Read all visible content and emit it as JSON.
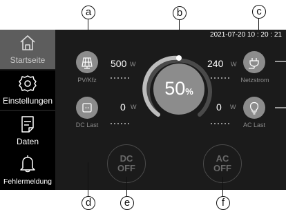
{
  "callouts": {
    "a": "a",
    "b": "b",
    "c": "c",
    "d": "d",
    "e": "e",
    "f": "f"
  },
  "datetime": "2021-07-20  10 : 20 : 21",
  "sidebar": {
    "items": [
      {
        "label": "Startseite",
        "icon": "home-icon",
        "active": true
      },
      {
        "label": "Einstellungen",
        "icon": "gear-icon",
        "active": false
      },
      {
        "label": "Daten",
        "icon": "document-icon",
        "active": false
      },
      {
        "label": "Fehlermeldung",
        "icon": "bell-icon",
        "active": false
      }
    ]
  },
  "gauge": {
    "value": "50",
    "unit": "%",
    "level": 0.5
  },
  "pv": {
    "label": "PV/Kfz",
    "value": "500",
    "unit": "W"
  },
  "dc_load": {
    "label": "DC Last",
    "value": "0",
    "unit": "W"
  },
  "grid": {
    "label": "Netzstrom",
    "value": "240",
    "unit": "W"
  },
  "ac_load": {
    "label": "AC Last",
    "value": "0",
    "unit": "W"
  },
  "dc_button": {
    "line1": "DC",
    "line2": "OFF"
  },
  "ac_button": {
    "line1": "AC",
    "line2": "OFF"
  },
  "colors": {
    "screen_bg": "#1b1b1b",
    "active_nav": "#5d5d5d",
    "icon_circle": "#8c8c8c"
  }
}
